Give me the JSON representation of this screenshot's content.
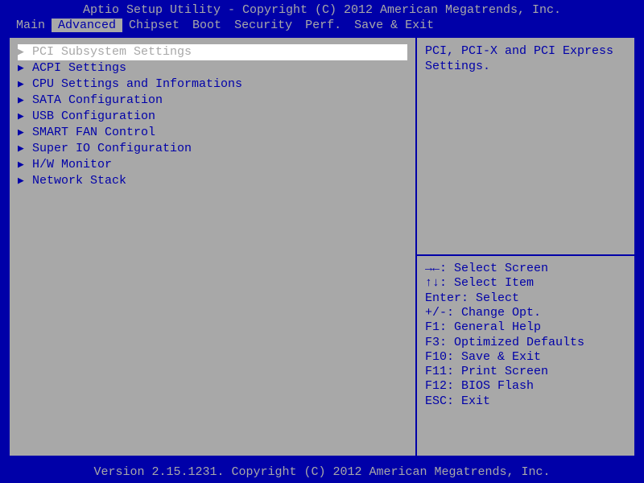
{
  "title": "Aptio Setup Utility - Copyright (C) 2012 American Megatrends, Inc.",
  "tabs": [
    {
      "id": "main",
      "label": "Main",
      "active": false
    },
    {
      "id": "advanced",
      "label": "Advanced",
      "active": true
    },
    {
      "id": "chipset",
      "label": "Chipset",
      "active": false
    },
    {
      "id": "boot",
      "label": "Boot",
      "active": false
    },
    {
      "id": "security",
      "label": "Security",
      "active": false
    },
    {
      "id": "perf",
      "label": "Perf.",
      "active": false
    },
    {
      "id": "saveexit",
      "label": "Save & Exit",
      "active": false
    }
  ],
  "menu": [
    {
      "id": "pci",
      "label": "PCI Subsystem Settings",
      "selected": true
    },
    {
      "id": "acpi",
      "label": "ACPI Settings",
      "selected": false
    },
    {
      "id": "cpu",
      "label": "CPU Settings and Informations",
      "selected": false
    },
    {
      "id": "sata",
      "label": "SATA Configuration",
      "selected": false
    },
    {
      "id": "usb",
      "label": "USB Configuration",
      "selected": false
    },
    {
      "id": "smartfan",
      "label": "SMART FAN Control",
      "selected": false
    },
    {
      "id": "superio",
      "label": "Super IO Configuration",
      "selected": false
    },
    {
      "id": "hwmon",
      "label": "H/W Monitor",
      "selected": false
    },
    {
      "id": "netstack",
      "label": "Network Stack",
      "selected": false
    }
  ],
  "help_text": "PCI, PCI-X and PCI Express Settings.",
  "keys": [
    {
      "k": "→←",
      "d": "Select Screen"
    },
    {
      "k": "↑↓",
      "d": "Select Item"
    },
    {
      "k": "Enter",
      "d": "Select"
    },
    {
      "k": "+/-",
      "d": "Change Opt."
    },
    {
      "k": "F1",
      "d": "General Help"
    },
    {
      "k": "F3",
      "d": "Optimized Defaults"
    },
    {
      "k": "F10",
      "d": "Save & Exit"
    },
    {
      "k": "F11",
      "d": "Print Screen"
    },
    {
      "k": "F12",
      "d": "BIOS Flash"
    },
    {
      "k": "ESC",
      "d": "Exit"
    }
  ],
  "footer": "Version 2.15.1231. Copyright (C) 2012 American Megatrends, Inc."
}
